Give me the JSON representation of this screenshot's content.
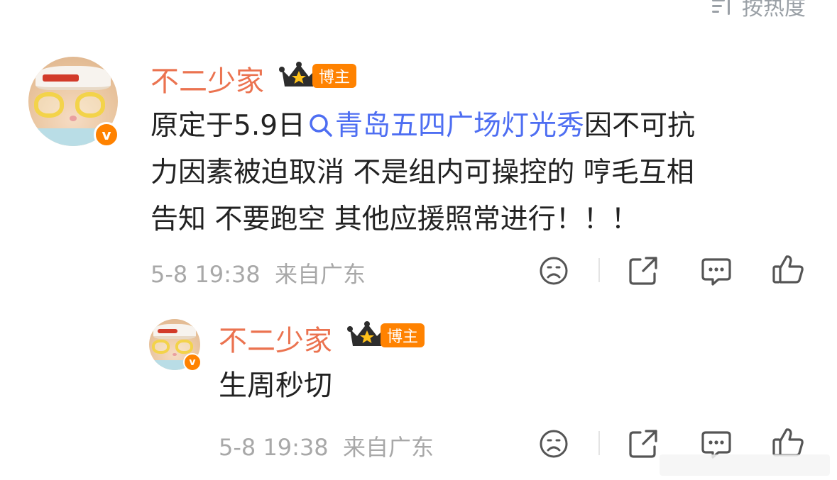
{
  "sort": {
    "label": "按热度"
  },
  "comment": {
    "username": "不二少家",
    "badge": "博主",
    "text_before": "原定于5.9日",
    "topic": "青岛五四广场灯光秀",
    "text_line1_after": "因不可抗",
    "text_line2": "力因素被迫取消 不是组内可操控的 哼毛互相",
    "text_line3": "告知 不要跑空 其他应援照常进行！！！",
    "time": "5-8 19:38",
    "location": "来自广东",
    "verified_mark": "v"
  },
  "reply": {
    "username": "不二少家",
    "badge": "博主",
    "text": "生周秒切",
    "time": "5-8 19:38",
    "location": "来自广东",
    "verified_mark": "v"
  },
  "icons": {
    "dislike": "sad-face-icon",
    "share": "share-icon",
    "comment": "comment-icon",
    "like": "thumbs-up-icon",
    "search": "search-icon",
    "crown": "crown-icon",
    "sort": "sort-icon"
  },
  "colors": {
    "username": "#eb7350",
    "badge_bg": "#ff8200",
    "topic_link": "#4e6ef2",
    "meta_text": "#a8a8a8",
    "body_text": "#222222"
  }
}
